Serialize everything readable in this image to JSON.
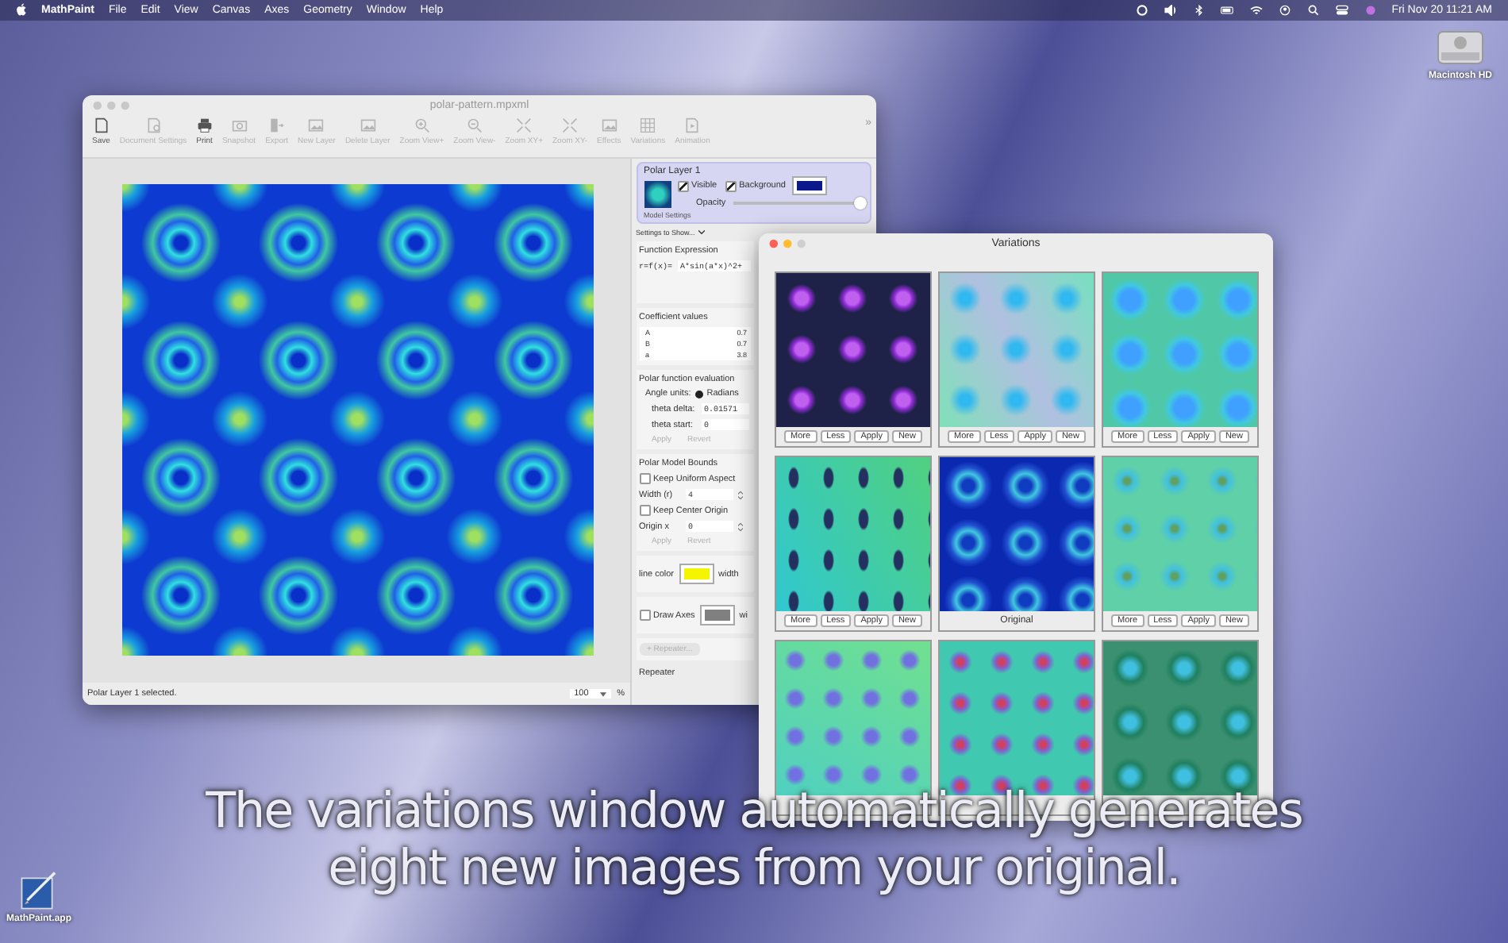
{
  "menubar": {
    "app_name": "MathPaint",
    "menus": [
      "File",
      "Edit",
      "View",
      "Canvas",
      "Axes",
      "Geometry",
      "Window",
      "Help"
    ],
    "clock": "Fri Nov 20  11:21 AM"
  },
  "desktop_icons": [
    {
      "label": "Macintosh HD",
      "kind": "disk"
    },
    {
      "label": "MathPaint.app",
      "kind": "app"
    }
  ],
  "main_window": {
    "title": "polar-pattern.mpxml",
    "toolbar": [
      {
        "label": "Save",
        "disabled": false
      },
      {
        "label": "Document Settings",
        "disabled": true
      },
      {
        "label": "Print",
        "disabled": false
      },
      {
        "label": "Snapshot",
        "disabled": true
      },
      {
        "label": "Export",
        "disabled": true
      },
      {
        "label": "New Layer",
        "disabled": true
      },
      {
        "label": "Delete Layer",
        "disabled": true
      },
      {
        "label": "Zoom View+",
        "disabled": true
      },
      {
        "label": "Zoom View-",
        "disabled": true
      },
      {
        "label": "Zoom XY+",
        "disabled": true
      },
      {
        "label": "Zoom XY-",
        "disabled": true
      },
      {
        "label": "Effects",
        "disabled": true
      },
      {
        "label": "Variations",
        "disabled": true
      },
      {
        "label": "Animation",
        "disabled": true
      }
    ],
    "overflow": "»",
    "status": "Polar Layer 1 selected.",
    "zoom": "100",
    "zoom_unit": "%",
    "layer": {
      "name": "Polar Layer 1",
      "visible_label": "Visible",
      "visible": true,
      "background_label": "Background",
      "background": true,
      "background_swatch": {
        "color": "#0a1a8c"
      },
      "opacity_label": "Opacity",
      "opacity": {
        "level": 0.97
      },
      "settings_label": "Model Settings"
    },
    "settings_menu": "Settings to Show...",
    "function": {
      "heading": "Function Expression",
      "prefix": "r=f(x)=",
      "value": "A*sin(a*x)^2+"
    },
    "coefficients": {
      "heading": "Coefficient values",
      "rows": [
        {
          "name": "A",
          "value": "0.7"
        },
        {
          "name": "B",
          "value": "0.7"
        },
        {
          "name": "a",
          "value": "3.8"
        }
      ]
    },
    "evaluation": {
      "heading": "Polar function evaluation",
      "angle_label": "Angle units:",
      "angle_options": [
        {
          "label": "Radians",
          "selected": true
        }
      ],
      "fields": [
        {
          "label": "theta delta:",
          "value": "0.01571"
        },
        {
          "label": "theta start:",
          "value": "0"
        }
      ],
      "buttons": [
        {
          "label": "Apply",
          "disabled": true
        },
        {
          "label": "Revert",
          "disabled": true
        }
      ]
    },
    "bounds": {
      "heading": "Polar Model Bounds",
      "rows": [
        {
          "kind": "checkbox",
          "label": "Keep Uniform Aspect",
          "checked": false
        },
        {
          "kind": "stepper",
          "label": "Width (r)",
          "value": "4"
        },
        {
          "kind": "checkbox",
          "label": "Keep Center Origin",
          "checked": false
        },
        {
          "kind": "stepper",
          "label": "Origin x",
          "value": "0"
        }
      ],
      "buttons": [
        {
          "label": "Apply",
          "disabled": true
        },
        {
          "label": "Revert",
          "disabled": true
        }
      ]
    },
    "line": {
      "label": "line color",
      "color": "#f5f500",
      "width_label": "width"
    },
    "axes": {
      "label": "Draw Axes",
      "checked": false,
      "color": "#808080",
      "width_label": "wi"
    },
    "repeater_button": {
      "label": "+ Repeater...",
      "disabled": true
    },
    "repeater_heading": "Repeater"
  },
  "variations_window": {
    "title": "Variations",
    "tiles": [
      {
        "kind": "buttons",
        "buttons": [
          "More",
          "Less",
          "Apply",
          "New"
        ]
      },
      {
        "kind": "buttons",
        "buttons": [
          "More",
          "Less",
          "Apply",
          "New"
        ]
      },
      {
        "kind": "buttons",
        "buttons": [
          "More",
          "Less",
          "Apply",
          "New"
        ]
      },
      {
        "kind": "buttons",
        "buttons": [
          "More",
          "Less",
          "Apply",
          "New"
        ]
      },
      {
        "kind": "label",
        "label": "Original"
      },
      {
        "kind": "buttons",
        "buttons": [
          "More",
          "Less",
          "Apply",
          "New"
        ]
      },
      {
        "kind": "hidden"
      },
      {
        "kind": "hidden"
      },
      {
        "kind": "hidden"
      }
    ]
  },
  "caption": [
    "The variations window automatically generates",
    "eight new images from your original."
  ]
}
